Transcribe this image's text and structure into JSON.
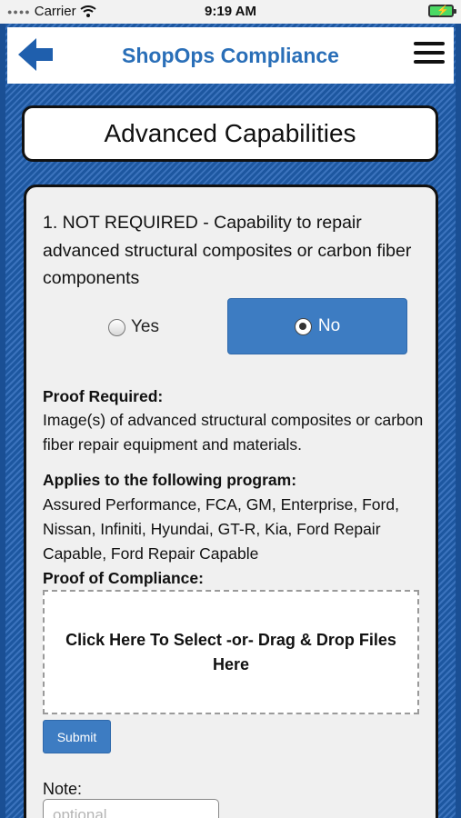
{
  "status_bar": {
    "carrier": "Carrier",
    "time": "9:19 AM"
  },
  "header": {
    "title": "ShopOps Compliance"
  },
  "page": {
    "title": "Advanced Capabilities"
  },
  "question": {
    "text": "1. NOT REQUIRED - Capability to repair advanced structural composites or carbon fiber components",
    "options": {
      "yes": "Yes",
      "no": "No"
    },
    "selected": "No"
  },
  "proof": {
    "label": "Proof Required:",
    "text": "Image(s) of advanced structural composites or carbon fiber repair equipment and materials."
  },
  "programs": {
    "label": "Applies to the following program:",
    "text": "Assured Performance, FCA, GM, Enterprise, Ford, Nissan, Infiniti, Hyundai, GT-R, Kia, Ford Repair Capable, Ford Repair Capable"
  },
  "compliance": {
    "label": "Proof of Compliance:",
    "dropzone_text": "Click Here To Select -or- Drag & Drop Files Here",
    "submit_label": "Submit"
  },
  "note": {
    "label": "Note:",
    "placeholder": "optional",
    "value": ""
  },
  "colors": {
    "accent": "#3d7cc2",
    "title_blue": "#2a6fb8",
    "frame_blue": "#1e5aa5"
  },
  "icons": {
    "back": "back-arrow-icon",
    "menu": "hamburger-menu-icon",
    "wifi": "wifi-icon",
    "battery": "battery-charging-icon"
  }
}
